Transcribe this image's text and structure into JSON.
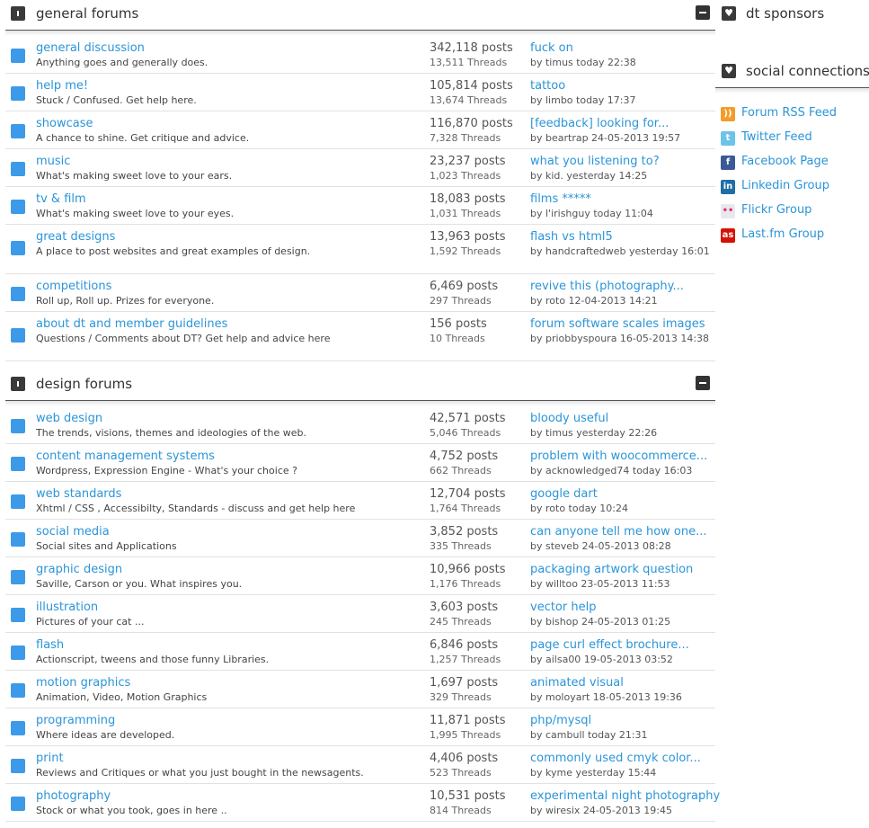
{
  "general": {
    "title": "general forums",
    "forums": [
      {
        "title": "general discussion",
        "desc": "Anything goes and generally does.",
        "posts": "342,118 posts",
        "threads": "13,511 Threads",
        "last_title": "fuck on",
        "last_by": "by timus today 22:38"
      },
      {
        "title": "help me!",
        "desc": "Stuck / Confused. Get help here.",
        "posts": "105,814 posts",
        "threads": "13,674 Threads",
        "last_title": "tattoo",
        "last_by": "by limbo today 17:37"
      },
      {
        "title": "showcase",
        "desc": "A chance to shine. Get critique and advice.",
        "posts": "116,870 posts",
        "threads": "7,328 Threads",
        "last_title": "[feedback] looking for...",
        "last_by": "by beartrap 24-05-2013 19:57"
      },
      {
        "title": "music",
        "desc": "What's making sweet love to your ears.",
        "posts": "23,237 posts",
        "threads": "1,023 Threads",
        "last_title": "what you listening to?",
        "last_by": "by kid. yesterday 14:25"
      },
      {
        "title": "tv & film",
        "desc": "What's making sweet love to your eyes.",
        "posts": "18,083 posts",
        "threads": "1,031 Threads",
        "last_title": "films *****",
        "last_by": "by l'irishguy today 11:04"
      },
      {
        "title": "great designs",
        "desc": "A place to post websites and great examples of design.",
        "posts": "13,963 posts",
        "threads": "1,592 Threads",
        "last_title": "flash vs html5",
        "last_by": "by handcraftedweb yesterday 16:01"
      },
      {
        "title": "competitions",
        "desc": "Roll up, Roll up. Prizes for everyone.",
        "posts": "6,469 posts",
        "threads": "297 Threads",
        "last_title": "revive this (photography...",
        "last_by": "by roto 12-04-2013 14:21"
      },
      {
        "title": "about dt and member guidelines",
        "desc": "Questions / Comments about DT? Get help and advice here",
        "posts": "156 posts",
        "threads": "10 Threads",
        "last_title": "forum software scales images",
        "last_by": "by priobbyspoura 16-05-2013 14:38"
      }
    ]
  },
  "design": {
    "title": "design forums",
    "forums": [
      {
        "title": "web design",
        "desc": "The trends, visions, themes and ideologies of the web.",
        "posts": "42,571 posts",
        "threads": "5,046 Threads",
        "last_title": "bloody useful",
        "last_by": "by timus yesterday 22:26"
      },
      {
        "title": "content management systems",
        "desc": "Wordpress, Expression Engine - What's your choice ?",
        "posts": "4,752 posts",
        "threads": "662 Threads",
        "last_title": "problem with woocommerce...",
        "last_by": "by acknowledged74 today 16:03"
      },
      {
        "title": "web standards",
        "desc": "Xhtml / CSS , Accessibilty, Standards - discuss and get help here",
        "posts": "12,704 posts",
        "threads": "1,764 Threads",
        "last_title": "google dart",
        "last_by": "by roto today 10:24"
      },
      {
        "title": "social media",
        "desc": "Social sites and Applications",
        "posts": "3,852 posts",
        "threads": "335 Threads",
        "last_title": "can anyone tell me how one...",
        "last_by": "by steveb 24-05-2013 08:28"
      },
      {
        "title": "graphic design",
        "desc": "Saville, Carson or you. What inspires you.",
        "posts": "10,966 posts",
        "threads": "1,176 Threads",
        "last_title": "packaging artwork question",
        "last_by": "by willtoo 23-05-2013 11:53"
      },
      {
        "title": "illustration",
        "desc": "Pictures of your cat ...",
        "posts": "3,603 posts",
        "threads": "245 Threads",
        "last_title": "vector help",
        "last_by": "by bishop 24-05-2013 01:25"
      },
      {
        "title": "flash",
        "desc": "Actionscript, tweens and those funny Libraries.",
        "posts": "6,846 posts",
        "threads": "1,257 Threads",
        "last_title": "page curl effect brochure...",
        "last_by": "by ailsa00 19-05-2013 03:52"
      },
      {
        "title": "motion graphics",
        "desc": "Animation, Video, Motion Graphics",
        "posts": "1,697 posts",
        "threads": "329 Threads",
        "last_title": "animated visual",
        "last_by": "by moloyart 18-05-2013 19:36"
      },
      {
        "title": "programming",
        "desc": "Where ideas are developed.",
        "posts": "11,871 posts",
        "threads": "1,995 Threads",
        "last_title": "php/mysql",
        "last_by": "by cambull today 21:31"
      },
      {
        "title": "print",
        "desc": "Reviews and Critiques or what you just bought in the newsagents.",
        "posts": "4,406 posts",
        "threads": "523 Threads",
        "last_title": "commonly used cmyk color...",
        "last_by": "by kyme yesterday 15:44"
      },
      {
        "title": "photography",
        "desc": "Stock or what you took, goes in here ..",
        "posts": "10,531 posts",
        "threads": "814 Threads",
        "last_title": "experimental night photography",
        "last_by": "by wiresix 24-05-2013 19:45"
      }
    ]
  },
  "sidebar": {
    "sponsors_title": "dt sponsors",
    "social_title": "social connections",
    "links": [
      {
        "label": "Forum RSS Feed",
        "icon": "rss-icon",
        "color": "#f39c2b",
        "glyph": "))"
      },
      {
        "label": "Twitter Feed",
        "icon": "twitter-icon",
        "color": "#6cc3ea",
        "glyph": "t"
      },
      {
        "label": "Facebook Page",
        "icon": "facebook-icon",
        "color": "#3b5998",
        "glyph": "f"
      },
      {
        "label": "Linkedin Group",
        "icon": "linkedin-icon",
        "color": "#1f6fa5",
        "glyph": "in"
      },
      {
        "label": "Flickr Group",
        "icon": "flickr-icon",
        "color": "#e8e8ee",
        "glyph": "••"
      },
      {
        "label": "Last.fm Group",
        "icon": "lastfm-icon",
        "color": "#d51007",
        "glyph": "as"
      }
    ]
  }
}
